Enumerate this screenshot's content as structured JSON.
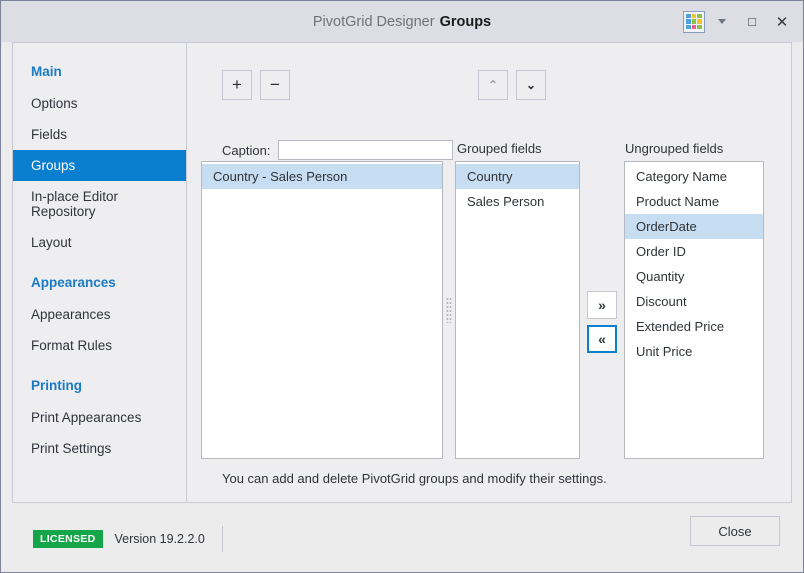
{
  "window": {
    "title_prefix": "PivotGrid Designer",
    "title_subject": "Groups",
    "skin_icon": "color-grid-icon",
    "skin_dropdown_icon": "chevron-down-icon",
    "maximize_icon": "□",
    "close_icon": "✕",
    "border_color": "#7d8499",
    "titlebar_color": "#dddee4"
  },
  "sidebar": {
    "groups": [
      {
        "label": "Main",
        "items": [
          {
            "label": "Options",
            "selected": false
          },
          {
            "label": "Fields",
            "selected": false
          },
          {
            "label": "Groups",
            "selected": true
          },
          {
            "label": "In-place Editor Repository",
            "selected": false
          },
          {
            "label": "Layout",
            "selected": false
          }
        ]
      },
      {
        "label": "Appearances",
        "items": [
          {
            "label": "Appearances",
            "selected": false
          },
          {
            "label": "Format Rules",
            "selected": false
          }
        ]
      },
      {
        "label": "Printing",
        "items": [
          {
            "label": "Print Appearances",
            "selected": false
          },
          {
            "label": "Print Settings",
            "selected": false
          }
        ]
      }
    ],
    "accent_color": "#1a7bc4",
    "selected_color": "#0a7fd0"
  },
  "toolbar": {
    "add_label": "+",
    "remove_label": "−",
    "move_up_label": "⌃",
    "move_down_label": "⌄",
    "move_up_enabled": false,
    "move_down_enabled": true
  },
  "caption": {
    "label": "Caption:",
    "value": "",
    "placeholder": ""
  },
  "panels": {
    "groups_list": {
      "rows": [
        {
          "label": "Country - Sales Person",
          "selected": true
        }
      ]
    },
    "grouped_fields": {
      "label": "Grouped fields",
      "rows": [
        {
          "label": "Country",
          "selected": true
        },
        {
          "label": "Sales Person",
          "selected": false
        }
      ]
    },
    "ungrouped_fields": {
      "label": "Ungrouped fields",
      "rows": [
        {
          "label": "Category Name",
          "selected": false
        },
        {
          "label": "Product Name",
          "selected": false
        },
        {
          "label": "OrderDate",
          "selected": true
        },
        {
          "label": "Order ID",
          "selected": false
        },
        {
          "label": "Quantity",
          "selected": false
        },
        {
          "label": "Discount",
          "selected": false
        },
        {
          "label": "Extended Price",
          "selected": false
        },
        {
          "label": "Unit Price",
          "selected": false
        }
      ]
    },
    "selection_color": "#c7ddf2"
  },
  "move_buttons": {
    "to_ungrouped_label": "»",
    "to_grouped_label": "«",
    "focused": "to_grouped",
    "focus_color": "#0a7fd0"
  },
  "hint": "You can add and delete PivotGrid groups and modify their settings.",
  "footer": {
    "license_badge": "LICENSED",
    "version": "Version 19.2.2.0",
    "badge_color": "#15a64a",
    "close_label": "Close"
  }
}
